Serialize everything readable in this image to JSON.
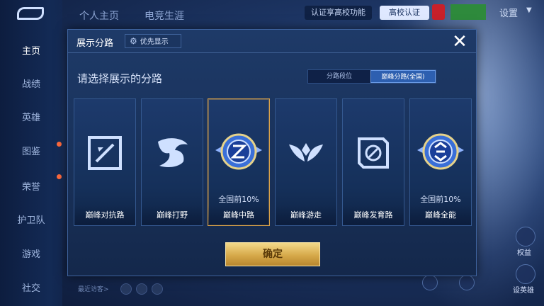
{
  "sidebar": {
    "items": [
      {
        "label": "主页",
        "active": true
      },
      {
        "label": "战绩"
      },
      {
        "label": "英雄"
      },
      {
        "label": "图鉴",
        "dot": true
      },
      {
        "label": "荣誉",
        "dot": true
      },
      {
        "label": "护卫队"
      },
      {
        "label": "游戏"
      },
      {
        "label": "社交"
      }
    ]
  },
  "top_bar": {
    "tabs": [
      "个人主页",
      "电竞生涯"
    ],
    "auth_text": "认证享高校功能",
    "auth_button": "高校认证",
    "settings_label": "设置"
  },
  "bottom": {
    "visitors_label": "最近访客>"
  },
  "right_panel": {
    "labels": [
      "权益",
      "设英雄"
    ]
  },
  "modal": {
    "title": "展示分路",
    "priority_button": "优先显示",
    "close_icon": "close-icon",
    "subtitle": "请选择展示的分路",
    "segment": {
      "options": [
        "分路段位",
        "巅峰分路(全国)"
      ],
      "selected_index": 1
    },
    "lanes": [
      {
        "name": "巅峰对抗路",
        "rank": "",
        "icon": "clash-lane-icon",
        "selected": false
      },
      {
        "name": "巅峰打野",
        "rank": "",
        "icon": "jungle-icon",
        "selected": false
      },
      {
        "name": "巅峰中路",
        "rank": "全国前10%",
        "icon": "mid-lane-emblem-icon",
        "selected": true
      },
      {
        "name": "巅峰游走",
        "rank": "",
        "icon": "roam-icon",
        "selected": false
      },
      {
        "name": "巅峰发育路",
        "rank": "",
        "icon": "farm-lane-icon",
        "selected": false
      },
      {
        "name": "巅峰全能",
        "rank": "全国前10%",
        "icon": "all-round-emblem-icon",
        "selected": false
      }
    ],
    "confirm_label": "确定"
  },
  "colors": {
    "accent_gold": "#d6a94a",
    "selected_border": "#d9a24a",
    "segment_active": "#2d5fb0"
  }
}
